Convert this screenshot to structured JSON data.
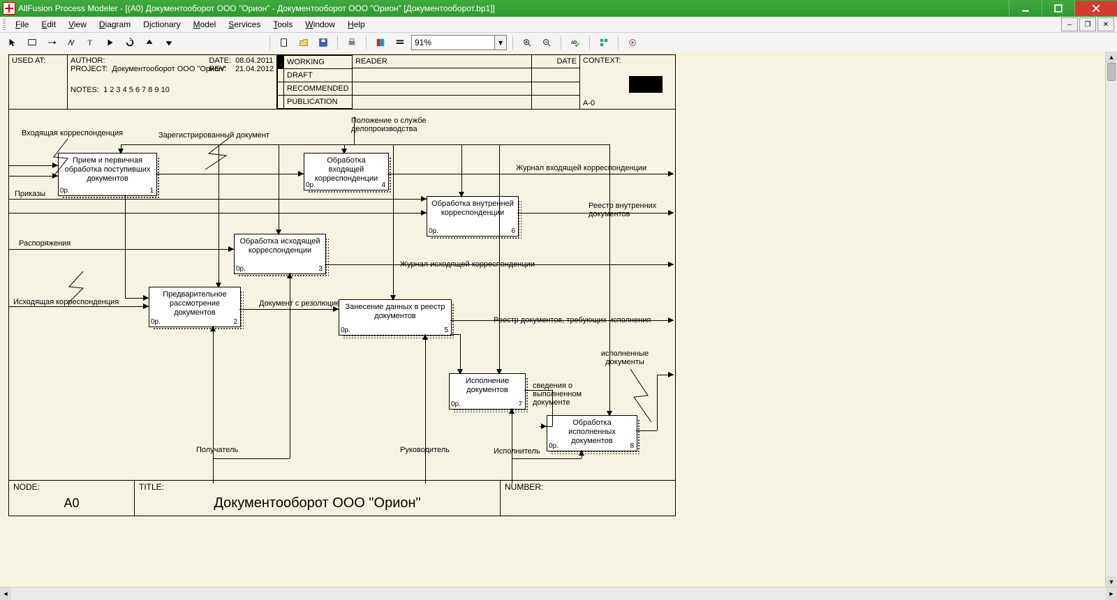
{
  "window": {
    "title": "AllFusion Process Modeler - [(A0) Документооборот  ООО \"Орион\" - Документооборот ООО \"Орион\"   [Документооборот.bp1]]"
  },
  "menu": {
    "items": [
      "File",
      "Edit",
      "View",
      "Diagram",
      "Dictionary",
      "Model",
      "Services",
      "Tools",
      "Window",
      "Help"
    ]
  },
  "toolbar": {
    "zoom_value": "91%"
  },
  "header": {
    "used_at": "USED AT:",
    "author_label": "AUTHOR:",
    "project_label": "PROJECT:",
    "project_value": "Документооборот ООО \"Орион\"",
    "date_label": "DATE:",
    "date_value": "08.04.2011",
    "rev_label": "REV:",
    "rev_value": "21.04.2012",
    "notes_label": "NOTES:",
    "notes_value": "1  2  3  4  5  6  7  8  9  10",
    "status": {
      "working": "WORKING",
      "draft": "DRAFT",
      "recommended": "RECOMMENDED",
      "publication": "PUBLICATION"
    },
    "reader": "READER",
    "date2": "DATE",
    "context": "CONTEXT:",
    "context_ref": "A-0"
  },
  "footer": {
    "node_label": "NODE:",
    "node_value": "A0",
    "title_label": "TITLE:",
    "title_value": "Документооборот  ООО \"Орион\"",
    "number_label": "NUMBER:"
  },
  "activities": [
    {
      "id": 1,
      "text": "Прием и первичная обработка поступивших документов",
      "cost": "0р.",
      "num": "1"
    },
    {
      "id": 2,
      "text": "Предварительное рассмотрение документов",
      "cost": "0р.",
      "num": "2"
    },
    {
      "id": 3,
      "text": "Обработка исходящей корреспонденции",
      "cost": "0р.",
      "num": "3"
    },
    {
      "id": 4,
      "text": "Обработка входящей корреспонденции",
      "cost": "0р.",
      "num": "4"
    },
    {
      "id": 5,
      "text": "Занесение данных в реестр документов",
      "cost": "0р.",
      "num": "5"
    },
    {
      "id": 6,
      "text": "Обработка внутренней корреспонденции",
      "cost": "0р.",
      "num": "6"
    },
    {
      "id": 7,
      "text": "Исполнение документов",
      "cost": "0р.",
      "num": "7"
    },
    {
      "id": 8,
      "text": "Обработка исполненных документов",
      "cost": "0р.",
      "num": "8"
    }
  ],
  "labels": {
    "in1": "Входящая корреспонденция",
    "in2": "Приказы",
    "in3": "Распоряжения",
    "in4": "Исходящая корреспонденция",
    "top1": "Зарегистрированный документ",
    "top2": "Положение о службе делопроизводства",
    "mid1": "Документ с резолюцией",
    "out1": "Журнал входящей корреспонденции",
    "out2": "Реестр внутренних документов",
    "out3": "Журнал исходящей корреспонденции",
    "out4": "Реестр документов, требующих исполнения",
    "out5": "исполненные документы",
    "out6": "сведения о выполненном документе",
    "mech1": "Получатель",
    "mech2": "Руководитель",
    "mech3": "Исполнитель"
  }
}
